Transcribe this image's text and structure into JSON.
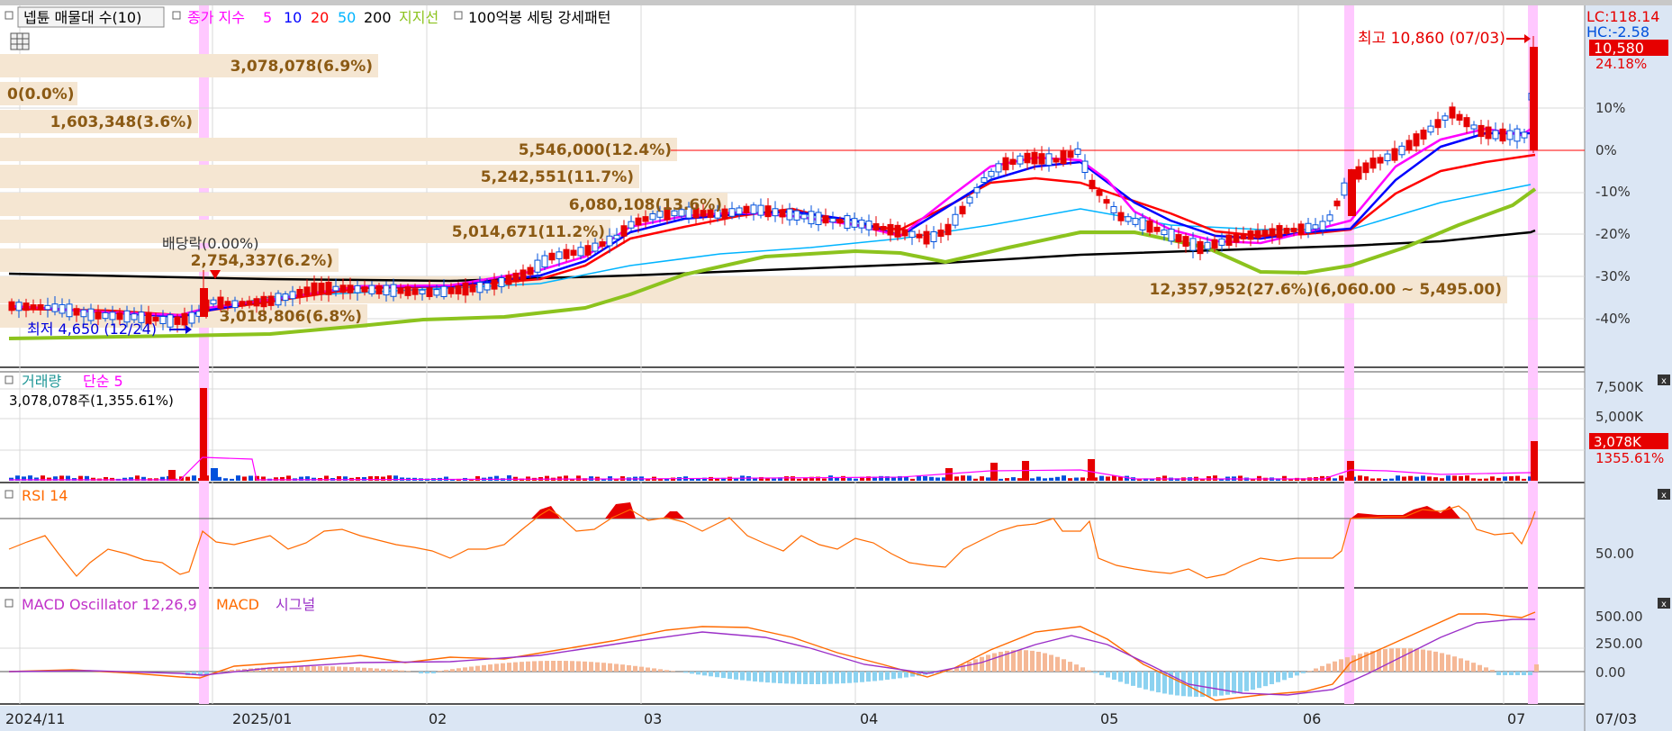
{
  "header": {
    "title": "넵튠 매물대 수(10)",
    "ma_label": "종가 지수",
    "ma_periods": [
      "5",
      "10",
      "20",
      "50",
      "200"
    ],
    "support_label": "지지선",
    "pattern_label": "100억봉 세팅 강세패턴"
  },
  "price_panel": {
    "lc": "LC:118.14",
    "hc": "HC:-2.58",
    "current_price_tag": "10,580",
    "pct_ticks": [
      "24.18%",
      "10%",
      "0%",
      "-10%",
      "-20%",
      "-30%",
      "-40%"
    ],
    "high_annotation": "최고 10,860 (07/03)",
    "low_annotation": "최저 4,650 (12/24)",
    "dividend_annotation": "배당락(0.00%)",
    "volume_profile": [
      "3,078,078(6.9%)",
      "0(0.0%)",
      "1,603,348(3.6%)",
      "5,546,000(12.4%)",
      "5,242,551(11.7%)",
      "6,080,108(13.6%)",
      "5,014,671(11.2%)",
      "2,754,337(6.2%)",
      "12,357,952(27.6%)(6,060.00 ~ 5,495.00)",
      "3,018,806(6.8%)"
    ]
  },
  "volume_panel": {
    "title": "거래량",
    "ma_label": "단순 5",
    "last_value": "3,078,078주(1,355.61%)",
    "ticks": [
      "7,500K",
      "5,000K"
    ],
    "current_tag": "3,078K",
    "current_pct": "1355.61%"
  },
  "rsi_panel": {
    "title": "RSI 14",
    "tick": "50.00"
  },
  "macd_panel": {
    "title": "MACD Oscillator 12,26,9",
    "macd_label": "MACD",
    "signal_label": "시그널",
    "ticks": [
      "500.00",
      "250.00",
      "0.00"
    ]
  },
  "x_axis": {
    "labels": [
      "2024/11",
      "2025/01",
      "02",
      "03",
      "04",
      "05",
      "06",
      "07"
    ],
    "current_date": "07/03"
  },
  "colors": {
    "ma5": "#ff00ff",
    "ma10": "#0000ff",
    "ma20": "#ff0000",
    "ma50": "#00b4ff",
    "ma200": "#000000",
    "support": "#8cc31e",
    "up_candle": "#e60000",
    "down_candle": "#0050dc",
    "rsi": "#ff6a00",
    "macd": "#ff6a00",
    "signal": "#9b30c8",
    "osc_pos": "#f5b896",
    "osc_neg": "#8cd2f0",
    "profile": "#f5e6d2",
    "highlight": "#ffc8ff"
  },
  "chart_data": {
    "type": "candlestick",
    "price_range": [
      4650,
      10860
    ],
    "high": {
      "value": 10860,
      "date": "07/03"
    },
    "low": {
      "value": 4650,
      "date": "12/24"
    },
    "last": {
      "close": 10580,
      "date": "07/03"
    },
    "monthly_close_approx": [
      {
        "month": "2024/11",
        "close": 4900
      },
      {
        "month": "2025/01",
        "close": 5300
      },
      {
        "month": "02",
        "close": 5700
      },
      {
        "month": "03",
        "close": 7200
      },
      {
        "month": "04",
        "close": 6500
      },
      {
        "month": "05",
        "close": 6700
      },
      {
        "month": "06",
        "close": 8500
      },
      {
        "month": "07",
        "close": 10580
      }
    ],
    "volume_last": 3078078,
    "rsi_level": 50.0,
    "macd_levels": [
      0,
      250,
      500
    ]
  }
}
